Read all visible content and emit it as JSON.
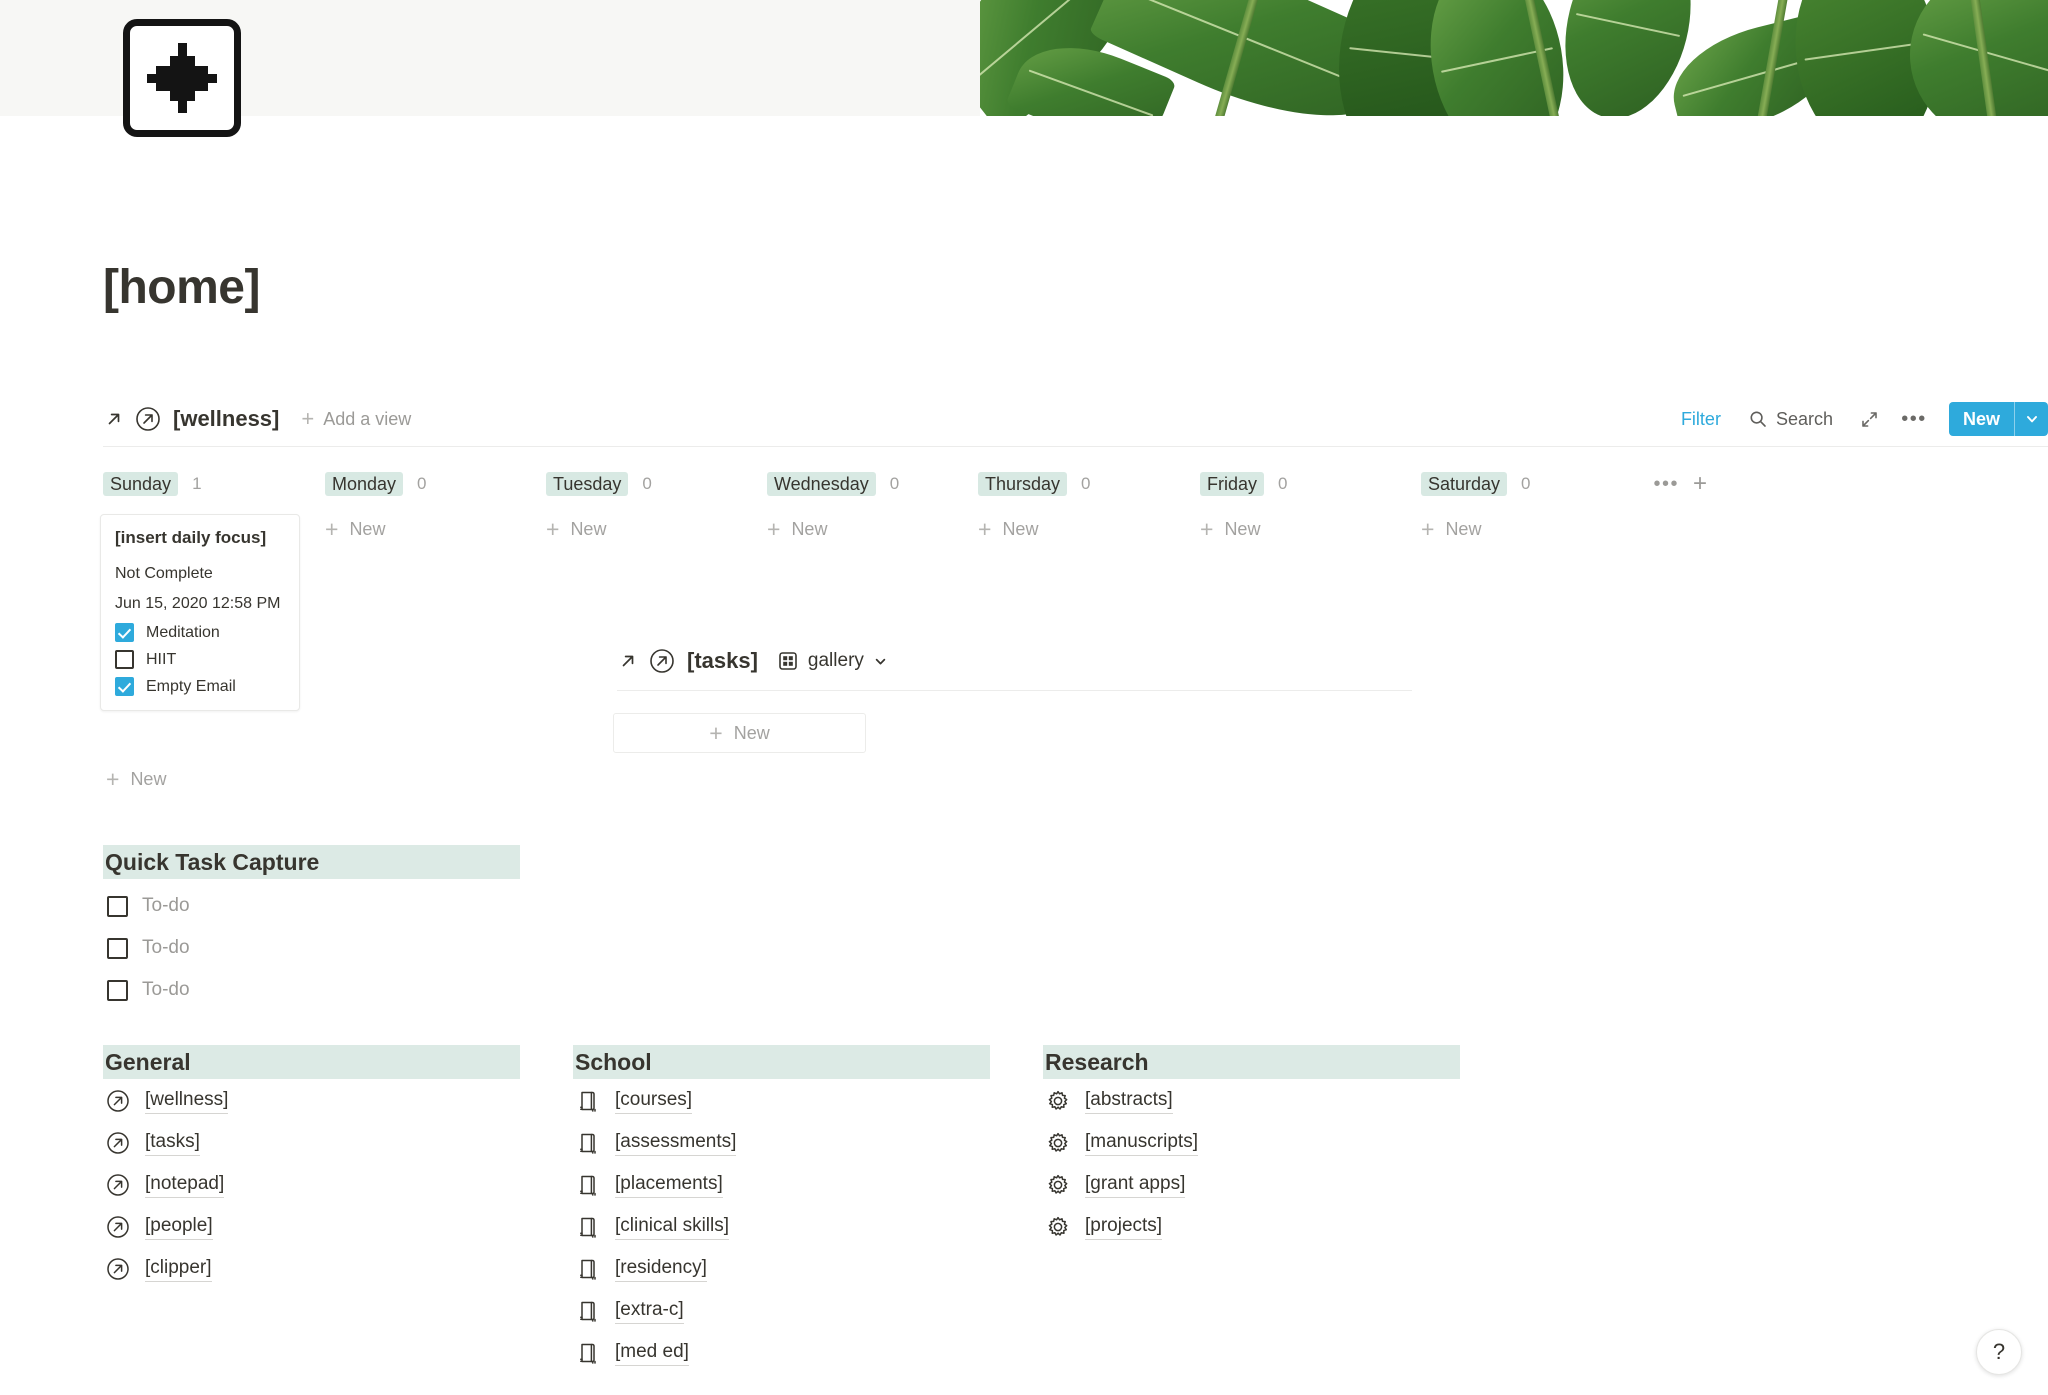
{
  "page": {
    "title": "[home]",
    "icon": "plus-page-icon",
    "cover": "plant-leaves-photo"
  },
  "wellness_view": {
    "open_icon": "arrow-up-right-icon",
    "link_icon": "arrow-up-right-circle-icon",
    "database_name": "[wellness]",
    "add_view_label": "Add a view",
    "filter_label": "Filter",
    "search_label": "Search",
    "expand_icon": "expand-icon",
    "more_icon": "more-horizontal-icon",
    "new_label": "New",
    "new_caret_icon": "chevron-down-icon",
    "accent_color": "#2eaadc",
    "chip_color": "#d8e9e3",
    "columns": [
      {
        "label": "Sunday",
        "count": "1",
        "new_label": "New"
      },
      {
        "label": "Monday",
        "count": "0",
        "new_label": "New"
      },
      {
        "label": "Tuesday",
        "count": "0",
        "new_label": "New"
      },
      {
        "label": "Wednesday",
        "count": "0",
        "new_label": "New"
      },
      {
        "label": "Thursday",
        "count": "0",
        "new_label": "New"
      },
      {
        "label": "Friday",
        "count": "0",
        "new_label": "New"
      },
      {
        "label": "Saturday",
        "count": "0",
        "new_label": "New"
      }
    ],
    "card": {
      "title": "[insert daily focus]",
      "status": "Not Complete",
      "date": "Jun 15, 2020 12:58 PM",
      "checklist": [
        {
          "label": "Meditation",
          "checked": true
        },
        {
          "label": "HIIT",
          "checked": false
        },
        {
          "label": "Empty Email",
          "checked": true
        }
      ]
    },
    "card_new_label": "New"
  },
  "quick_task_capture": {
    "heading": "Quick Task Capture",
    "heading_bg": "#dceae5",
    "todos": [
      {
        "label": "To-do",
        "checked": false
      },
      {
        "label": "To-do",
        "checked": false
      },
      {
        "label": "To-do",
        "checked": false
      }
    ]
  },
  "tasks_view": {
    "open_icon": "arrow-up-right-icon",
    "link_icon": "arrow-up-right-circle-icon",
    "database_name": "[tasks]",
    "view_icon": "gallery-grid-icon",
    "view_label": "gallery",
    "view_caret_icon": "chevron-down-icon",
    "new_label": "New"
  },
  "link_sections": [
    {
      "heading": "General",
      "icon": "arrow-up-right-circle-icon",
      "items": [
        {
          "label": "[wellness]"
        },
        {
          "label": "[tasks]"
        },
        {
          "label": "[notepad]"
        },
        {
          "label": "[people]"
        },
        {
          "label": "[clipper]"
        }
      ]
    },
    {
      "heading": "School",
      "icon": "closed-book-icon",
      "items": [
        {
          "label": "[courses]"
        },
        {
          "label": "[assessments]"
        },
        {
          "label": "[placements]"
        },
        {
          "label": "[clinical skills]"
        },
        {
          "label": "[residency]"
        },
        {
          "label": "[extra-c]"
        },
        {
          "label": "[med ed]"
        }
      ]
    },
    {
      "heading": "Research",
      "icon": "gear-icon",
      "items": [
        {
          "label": "[abstracts]"
        },
        {
          "label": "[manuscripts]"
        },
        {
          "label": "[grant apps]"
        },
        {
          "label": "[projects]"
        }
      ]
    }
  ],
  "help": {
    "label": "?"
  }
}
